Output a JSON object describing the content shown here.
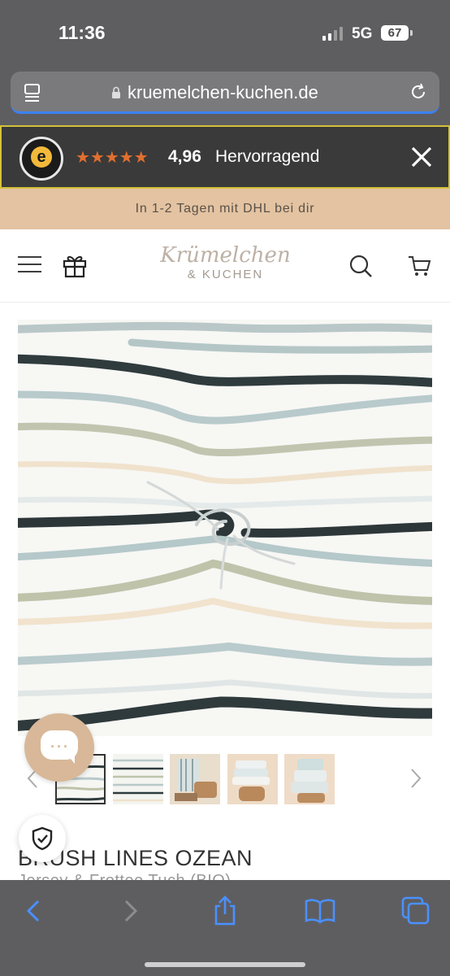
{
  "status_bar": {
    "time": "11:36",
    "network": "5G",
    "battery": "67"
  },
  "browser": {
    "url": "kruemelchen-kuchen.de"
  },
  "trusted_shops": {
    "stars": "★★★★★",
    "rating": "4,96",
    "rating_label": "Hervorragend"
  },
  "shipping_banner": {
    "text": "In 1-2 Tagen mit DHL bei dir"
  },
  "header": {
    "logo_script": "Krümelchen",
    "logo_sub": "& KUCHEN"
  },
  "product": {
    "title": "BRUSH LINES OZEAN",
    "subtitle_partial": "Jersey & Frottee Tuch (BIO)"
  },
  "colors": {
    "chrome": "#5e5e61",
    "accent_beige": "#e3c3a1",
    "stars": "#e26f2f",
    "ios_blue": "#3b82f6"
  },
  "icons": [
    "tabs-icon",
    "lock-icon",
    "reload-icon",
    "close-icon",
    "menu-icon",
    "gift-icon",
    "search-icon",
    "cart-icon",
    "chat-icon",
    "shield-check-icon",
    "back-icon",
    "forward-icon",
    "share-icon",
    "bookmarks-icon",
    "tabs-overview-icon"
  ]
}
